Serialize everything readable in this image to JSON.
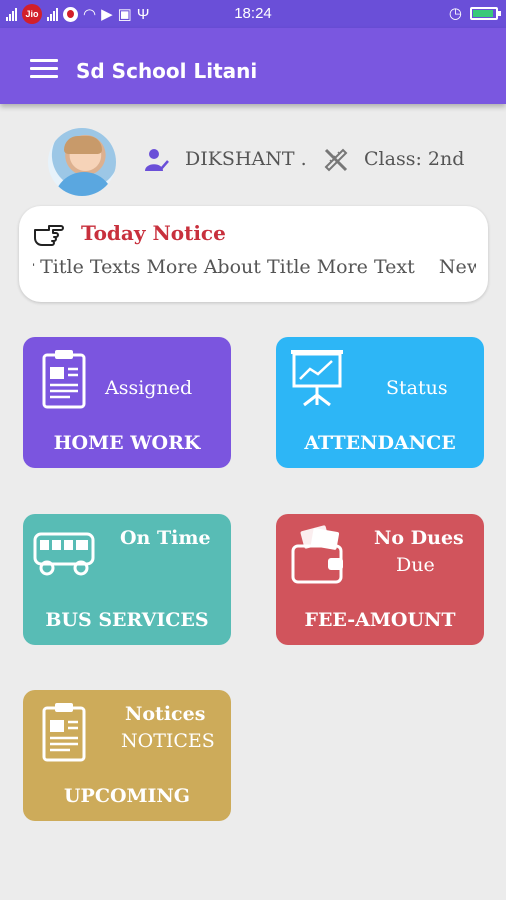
{
  "status_bar": {
    "carrier": "Jio",
    "time": "18:24"
  },
  "app_bar": {
    "title": "Sd School Litani"
  },
  "profile": {
    "name": "DIKSHANT .",
    "class_label": "Class: 2nd"
  },
  "notice": {
    "title": "Today Notice",
    "scroll_text": "r Title Texts More About Title More Text    New"
  },
  "tiles": [
    {
      "label": "HOME WORK",
      "status": "Assigned",
      "color": "#7b55df",
      "icon": "clipboard-icon"
    },
    {
      "label": "ATTENDANCE",
      "status": "Status",
      "color": "#2db6f6",
      "icon": "chart-board-icon"
    },
    {
      "label": "BUS SERVICES",
      "status": "On Time",
      "color": "#58bcb5",
      "icon": "bus-icon"
    },
    {
      "label": "FEE-AMOUNT",
      "status": "No Dues",
      "sub_status": "Due",
      "color": "#d1545c",
      "icon": "wallet-icon"
    },
    {
      "label": "UPCOMING",
      "status": "Notices",
      "sub_status": "NOTICES",
      "color": "#cdab5a",
      "icon": "clipboard-icon"
    }
  ],
  "colors": {
    "app_bar": "#7a57e0",
    "status_bar": "#6a4fd8",
    "notice_title": "#c8303d",
    "background": "#ececec"
  }
}
